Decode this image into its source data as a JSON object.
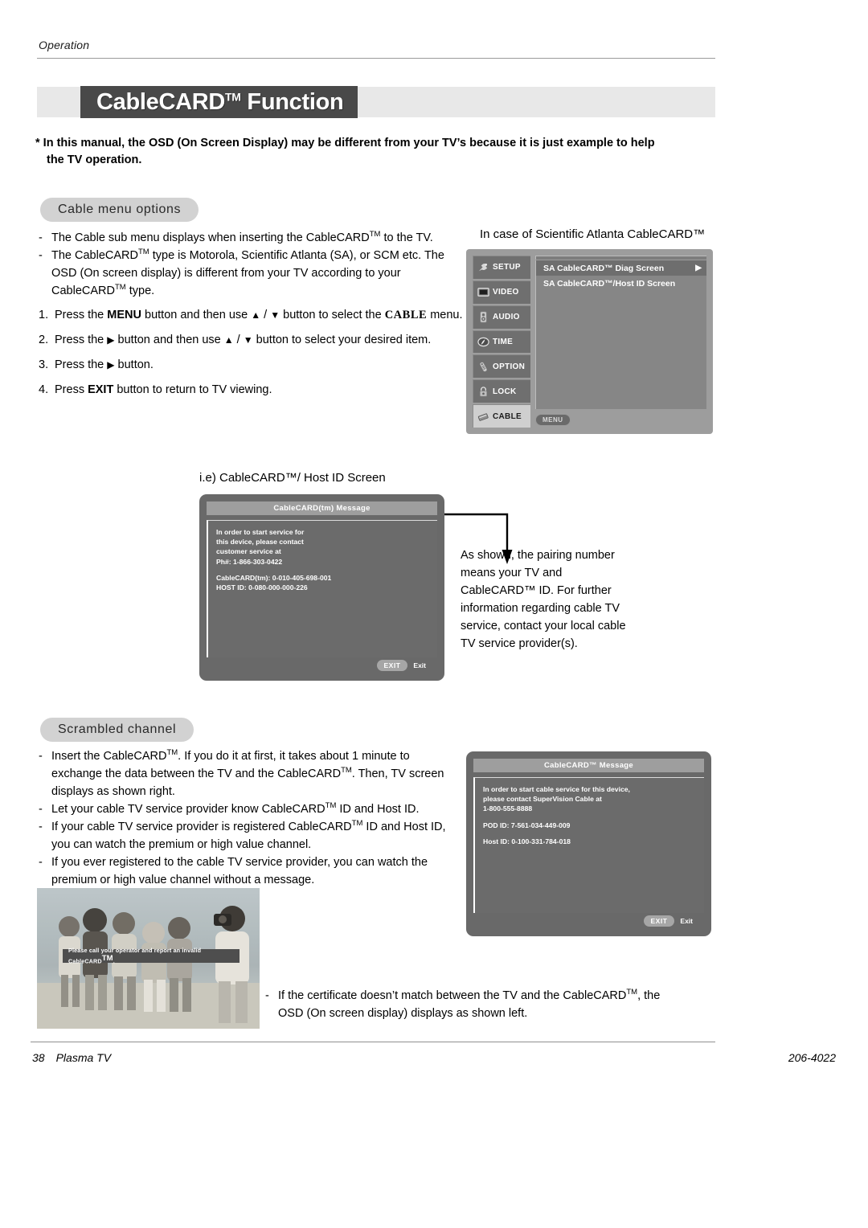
{
  "header": {
    "section_label": "Operation",
    "title": "CableCARD",
    "title_tm": "TM",
    "title_rest": " Function"
  },
  "note": {
    "line1": "* In this manual, the OSD (On Screen Display) may be different from your TV’s because it is just example to help",
    "line2": "the TV operation."
  },
  "sections": {
    "cable_menu_options": "Cable menu options",
    "scrambled_channel": "Scrambled channel"
  },
  "cable_menu": {
    "bullets": [
      {
        "dash": "-",
        "text_a": "The Cable sub menu displays when inserting the CableCARD",
        "tm": "TM",
        "text_b": " to the TV."
      },
      {
        "dash": "-",
        "text_a": "The CableCARD",
        "tm": "TM",
        "text_b": " type is Motorola, Scientific Atlanta (SA), or SCM etc. The OSD (On screen display) is different from your TV according to your CableCARD",
        "tm2": "TM",
        "text_c": " type."
      }
    ],
    "steps": [
      {
        "n": "1.",
        "pre": "Press the ",
        "kbd1": "MENU",
        "mid": " button and then use ",
        "up": "▲",
        "slash": " / ",
        "down": "▼",
        "mid2": " button to select the ",
        "kbd2": "CABLE",
        "post": " menu."
      },
      {
        "n": "2.",
        "pre": "Press the ",
        "arrow": "▶",
        "mid": " button and then use ",
        "up": "▲",
        "slash": " / ",
        "down": "▼",
        "post": " button to select your desired item."
      },
      {
        "n": "3.",
        "pre": "Press the ",
        "arrow": "▶",
        "post": " button."
      },
      {
        "n": "4.",
        "pre": "Press ",
        "kbd1": "EXIT",
        "post": " button to return to TV viewing."
      }
    ]
  },
  "osd_caption": "In case of Scientific Atlanta CableCARD™",
  "osd_menu": {
    "sidebar": [
      {
        "label": "SETUP",
        "icon": "satellite-dish-icon",
        "selected": false
      },
      {
        "label": "VIDEO",
        "icon": "monitor-icon",
        "selected": false
      },
      {
        "label": "AUDIO",
        "icon": "speaker-icon",
        "selected": false
      },
      {
        "label": "TIME",
        "icon": "clock-icon",
        "selected": false
      },
      {
        "label": "OPTION",
        "icon": "remote-control-icon",
        "selected": false
      },
      {
        "label": "LOCK",
        "icon": "padlock-icon",
        "selected": false
      },
      {
        "label": "CABLE",
        "icon": "cable-card-icon",
        "selected": true
      }
    ],
    "rows": [
      {
        "label": "SA CableCARD™ Diag Screen",
        "arrow": "▶",
        "highlighted": true
      },
      {
        "label": "SA CableCARD™/Host ID Screen",
        "arrow": "",
        "highlighted": false
      }
    ],
    "menu_button": "MENU"
  },
  "hostid_caption": "i.e) CableCARD™/ Host ID Screen",
  "dialog_hostid": {
    "title": "CableCARD(tm) Message",
    "lines": [
      "In order to start service for",
      "this device, please contact",
      "customer service at",
      "Ph#: 1-866-303-0422"
    ],
    "ids": [
      "CableCARD(tm): 0-010-405-698-001",
      "HOST ID: 0-080-000-000-226"
    ],
    "exit_button": "EXIT",
    "exit_label": "Exit"
  },
  "pairing_text": "As shown, the pairing number means your TV and CableCARD™ ID. For further information regarding cable TV service, contact your local cable TV service provider(s).",
  "scrambled": {
    "bullets": [
      {
        "dash": "-",
        "a": "Insert the CableCARD",
        "tm1": "TM",
        "b": ". If you do it at first, it takes about 1 minute to exchange the data between the TV and the CableCARD",
        "tm2": "TM",
        "c": ". Then, TV screen displays as shown right."
      },
      {
        "dash": "-",
        "a": "Let your cable TV service provider know CableCARD",
        "tm1": "TM",
        "b": " ID and Host ID."
      },
      {
        "dash": "-",
        "a": "If your cable TV service provider is registered CableCARD",
        "tm1": "TM",
        "b": " ID and Host ID, you can watch the premium or high value channel."
      },
      {
        "dash": "-",
        "a": "If you ever registered to the cable TV service provider, you can watch the premium or high value channel without a message."
      }
    ]
  },
  "dialog_scrambled": {
    "title": "CableCARD™ Message",
    "lines": [
      "In order to start cable service for this device,",
      "please contact SuperVision Cable at",
      "1-800-555-8888"
    ],
    "pod_id": "POD ID: 7-561-034-449-009",
    "host_id": "Host ID: 0-100-331-784-018",
    "exit_button": "EXIT",
    "exit_label": "Exit"
  },
  "photo": {
    "overlay_text_a": "Please call your operator and report an invalid CableCARD",
    "overlay_tm": "TM",
    "overlay_text_b": "."
  },
  "cert_bullet": {
    "dash": "-",
    "a": "If the certificate doesn’t match between the TV and the CableCARD",
    "tm": "TM",
    "b": ", the OSD (On screen display) displays as shown left."
  },
  "footer": {
    "page_number": "38",
    "product": "Plasma TV",
    "doc_code": "206-4022"
  },
  "colors": {
    "title_bar": "#494949",
    "title_band": "#e8e8e8",
    "pill": "#d2d2d2",
    "osd_panel": "#9d9d9d",
    "osd_sidebar_item": "#6f6f6f",
    "osd_selected": "#cfcfcf",
    "dialog_bg": "#696969",
    "dialog_title": "#9e9e9e"
  }
}
